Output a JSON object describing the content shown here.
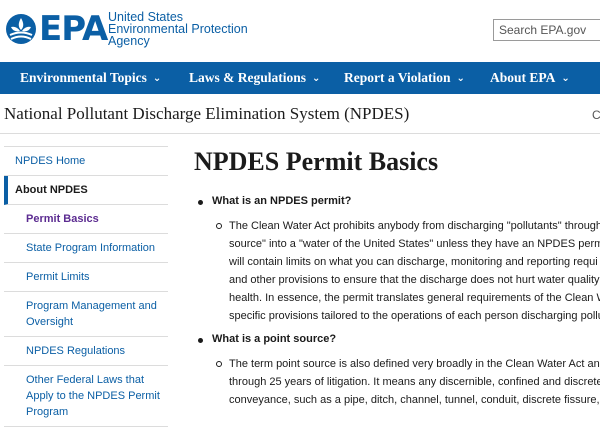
{
  "header": {
    "logo_text": "EPA",
    "agency_line1": "United States",
    "agency_line2": "Environmental Protection",
    "agency_line3": "Agency",
    "search_placeholder": "Search EPA.gov"
  },
  "nav": {
    "items": [
      {
        "label": "Environmental Topics",
        "icon": "chevron-down-icon"
      },
      {
        "label": "Laws & Regulations",
        "icon": "chevron-down-icon"
      },
      {
        "label": "Report a Violation",
        "icon": "chevron-down-icon"
      },
      {
        "label": "About EPA",
        "icon": "chevron-down-icon"
      }
    ]
  },
  "subheader": {
    "title": "National Pollutant Discharge Elimination System (NPDES)",
    "right_text": "C"
  },
  "sidebar": {
    "items": [
      {
        "label": "NPDES Home"
      },
      {
        "label": "About NPDES"
      },
      {
        "label": "Permit Basics"
      },
      {
        "label": "State Program Information"
      },
      {
        "label": "Permit Limits"
      },
      {
        "label": "Program Management and Oversight"
      },
      {
        "label": "NPDES Regulations"
      },
      {
        "label": "Other Federal Laws that Apply to the NPDES Permit Program"
      }
    ]
  },
  "main": {
    "title": "NPDES Permit Basics",
    "faq": [
      {
        "question": "What is an NPDES permit?",
        "answer_lines": [
          "The Clean Water Act prohibits anybody from discharging \"pollutants\" through",
          "source\" into a \"water of the United States\" unless they have an NPDES permit",
          "will contain limits on what you can discharge, monitoring and reporting requi",
          "and other provisions to ensure that the discharge does not hurt water quality",
          "health. In essence, the permit translates general requirements of the Clean Wa",
          "specific provisions tailored to the operations of each person discharging pollu"
        ]
      },
      {
        "question": "What is a point source?",
        "answer_lines": [
          "The term point source is also defined very broadly in the Clean Water Act and i",
          "through 25 years of litigation. It means any discernible, confined and discrete",
          "conveyance, such as a pipe, ditch, channel, tunnel, conduit, discrete fissure, o"
        ]
      }
    ]
  },
  "colors": {
    "brand_blue": "#0b5fa5",
    "current_purple": "#5c2c91"
  }
}
